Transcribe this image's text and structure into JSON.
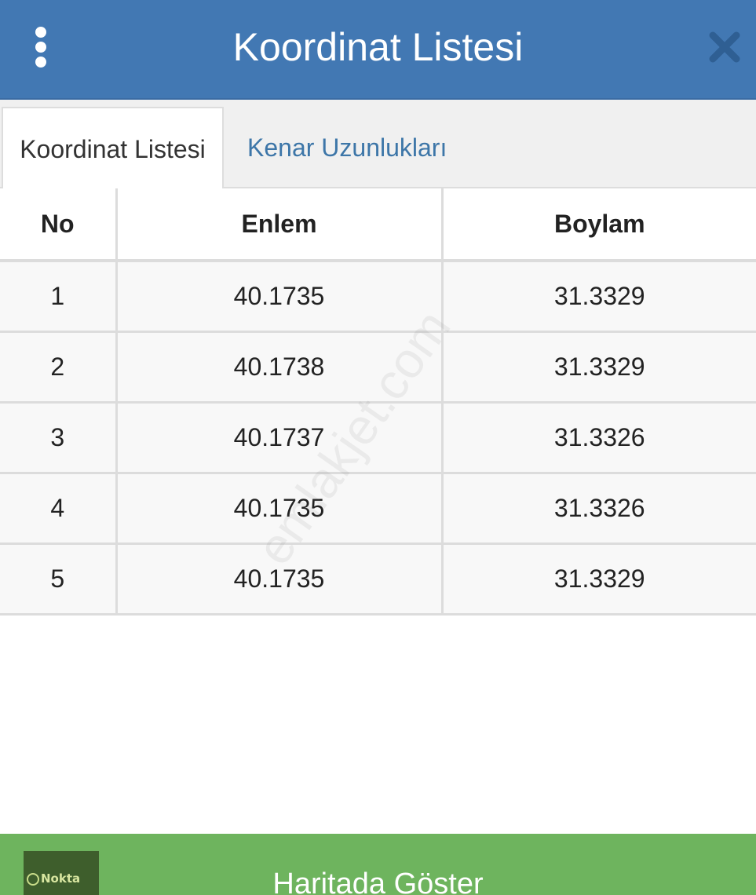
{
  "header": {
    "title": "Koordinat Listesi",
    "menu_icon": "vertical-dots-icon",
    "close_icon": "close-icon"
  },
  "tabs": [
    {
      "label": "Koordinat Listesi",
      "active": true
    },
    {
      "label": "Kenar Uzunlukları",
      "active": false
    }
  ],
  "table": {
    "headers": [
      "No",
      "Enlem",
      "Boylam"
    ],
    "rows": [
      [
        "1",
        "40.1735",
        "31.3329"
      ],
      [
        "2",
        "40.1738",
        "31.3329"
      ],
      [
        "3",
        "40.1737",
        "31.3326"
      ],
      [
        "4",
        "40.1735",
        "31.3326"
      ],
      [
        "5",
        "40.1735",
        "31.3329"
      ]
    ]
  },
  "watermark": "emlakjet.com",
  "footer": {
    "logo_text": "Nokta",
    "button_label": "Haritada Göster"
  },
  "colors": {
    "header_bg": "#4278b3",
    "tab_link": "#3d76a8",
    "footer_bg": "#6eb45e"
  }
}
